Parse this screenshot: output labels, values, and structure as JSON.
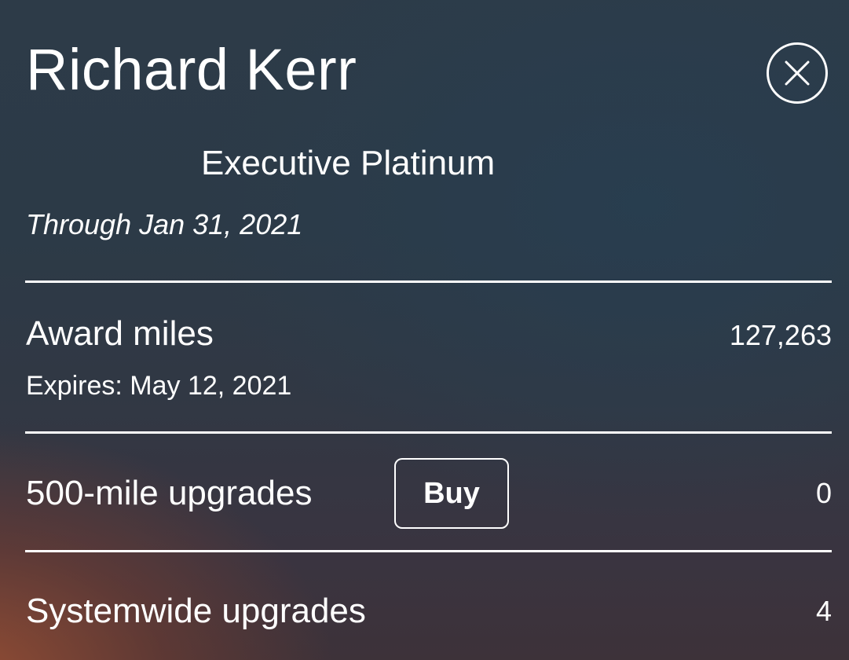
{
  "member": {
    "name": "Richard Kerr",
    "status": "Executive Platinum",
    "status_through": "Through Jan 31, 2021"
  },
  "icons": {
    "close": "close-icon"
  },
  "award_miles": {
    "label": "Award miles",
    "value": "127,263",
    "expires": "Expires: May 12, 2021"
  },
  "upgrades_500": {
    "label": "500-mile upgrades",
    "buy_label": "Buy",
    "value": "0"
  },
  "systemwide_upgrades": {
    "label": "Systemwide upgrades",
    "value": "4"
  },
  "colors": {
    "text": "#ffffff",
    "background_top": "#2d3b48",
    "background_bottom_left": "#964e34"
  }
}
